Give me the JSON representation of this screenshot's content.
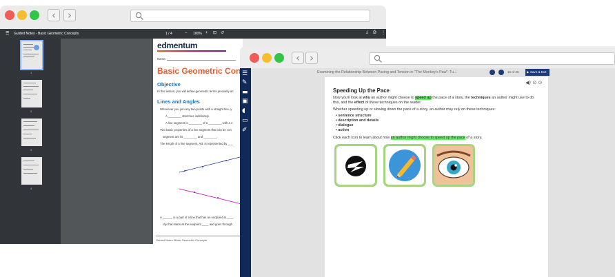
{
  "pdf_window": {
    "doc_title": "Guided Notes - Basic Geometric Concepts",
    "page_indicator": "1 / 4",
    "zoom": "100%",
    "thumbnail_numbers": [
      "1",
      "2",
      "3",
      "4"
    ],
    "page": {
      "brand": "edmentum",
      "name_label": "Name:",
      "title": "Basic Geometric Con",
      "objective_heading": "Objective",
      "objective_text": "In this lesson, you will define geometric terms precisely an",
      "lines_heading": "Lines and Angles",
      "bullet1": "Whenever you join any two points with a straight line, y",
      "sub1": "A ________ stretches indefinitely.",
      "sub2": "A line segment is ________ of a ________ with a n",
      "bullet2": "Two basic properties of a line segment that can be con",
      "bullet2b": "segment are its ________ and ________.",
      "bullet3": "The length of a line segment, AB, is represented by ___",
      "bullet4": "A ______ is a part of a line that has an endpoint at ____",
      "bullet4b": "ray that starts at the endpoint ____ and goes through",
      "footer": "Guided Notes: Basic Geometric Concepts"
    }
  },
  "lesson_window": {
    "lesson_title": "Examining the Relationship Between Pacing and Tension in \"The Monkey's Paw\": Tu...",
    "page_counter": "16 of 26",
    "save_exit_label": "Save & Exit",
    "content": {
      "heading": "Speeding Up the Pace",
      "p1_a": "Now you'll look at ",
      "p1_b": "why",
      "p1_c": " an author might choose to ",
      "p1_d": "speed up",
      "p1_e": " the pace of a story, the ",
      "p1_f": "techniques",
      "p1_g": " an author might use to do",
      "p2_a": "this, and the ",
      "p2_b": "effect",
      "p2_c": " of these techniques on the reader.",
      "p3": "Whether speeding up or slowing down the pace of a story, an author may rely on these techniques:",
      "techniques": [
        "sentence structure",
        "description and details",
        "dialogue",
        "action"
      ],
      "p4_a": "Click each icon to learn about how ",
      "p4_b": "an author might choose to speed up the pace",
      "p4_c": " of a story."
    },
    "icon_cards": [
      "speed-swoosh",
      "pencil",
      "wide-eye"
    ]
  },
  "colors": {
    "traffic_red": "#f25c56",
    "traffic_yellow": "#f6be2f",
    "traffic_green": "#33c44a",
    "sidebar_navy": "#0f2a57",
    "highlight_green": "#62f25f",
    "card_green": "#a5d57f",
    "accent_orange": "#f05a28"
  }
}
